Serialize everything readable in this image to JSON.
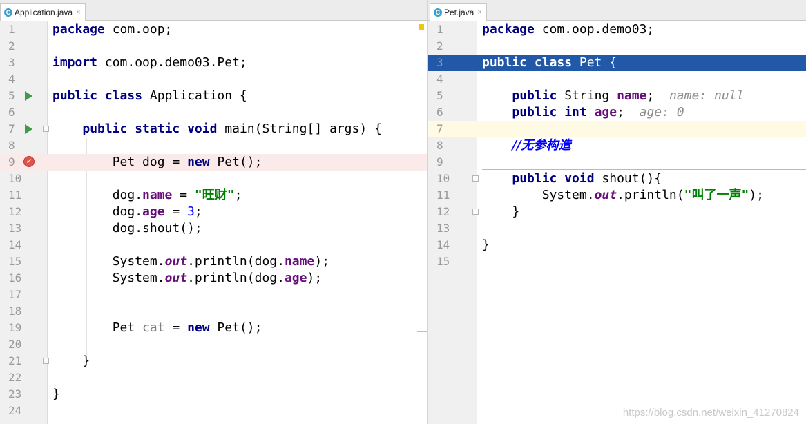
{
  "left_editor": {
    "tab": {
      "icon": "C",
      "name": "Application.java",
      "close": "×"
    },
    "lines": [
      {
        "n": "1",
        "tokens": [
          {
            "t": "package",
            "c": "kw"
          },
          {
            "t": " com.oop;"
          }
        ]
      },
      {
        "n": "2",
        "tokens": []
      },
      {
        "n": "3",
        "tokens": [
          {
            "t": "import",
            "c": "kw"
          },
          {
            "t": " com.oop.demo03.Pet;"
          }
        ]
      },
      {
        "n": "4",
        "tokens": []
      },
      {
        "n": "5",
        "gutter": "run",
        "tokens": [
          {
            "t": "public class",
            "c": "kw"
          },
          {
            "t": " Application {"
          }
        ]
      },
      {
        "n": "6",
        "tokens": []
      },
      {
        "n": "7",
        "gutter": "run",
        "fold": true,
        "tokens": [
          {
            "t": "    "
          },
          {
            "t": "public static void",
            "c": "kw"
          },
          {
            "t": " main(String[] args) {"
          }
        ]
      },
      {
        "n": "8",
        "tokens": []
      },
      {
        "n": "9",
        "gutter": "breakpoint",
        "highlight": "break",
        "tokens": [
          {
            "t": "        Pet dog = "
          },
          {
            "t": "new",
            "c": "kw"
          },
          {
            "t": " Pet();"
          }
        ]
      },
      {
        "n": "10",
        "tokens": []
      },
      {
        "n": "11",
        "tokens": [
          {
            "t": "        dog."
          },
          {
            "t": "name",
            "c": "fld"
          },
          {
            "t": " = "
          },
          {
            "t": "\"旺财\"",
            "c": "str"
          },
          {
            "t": ";"
          }
        ]
      },
      {
        "n": "12",
        "tokens": [
          {
            "t": "        dog."
          },
          {
            "t": "age",
            "c": "fld"
          },
          {
            "t": " = "
          },
          {
            "t": "3",
            "c": "num"
          },
          {
            "t": ";"
          }
        ]
      },
      {
        "n": "13",
        "tokens": [
          {
            "t": "        dog.shout();"
          }
        ]
      },
      {
        "n": "14",
        "tokens": []
      },
      {
        "n": "15",
        "tokens": [
          {
            "t": "        System."
          },
          {
            "t": "out",
            "c": "sfld"
          },
          {
            "t": ".println(dog."
          },
          {
            "t": "name",
            "c": "fld"
          },
          {
            "t": ");"
          }
        ]
      },
      {
        "n": "16",
        "tokens": [
          {
            "t": "        System."
          },
          {
            "t": "out",
            "c": "sfld"
          },
          {
            "t": ".println(dog."
          },
          {
            "t": "age",
            "c": "fld"
          },
          {
            "t": ");"
          }
        ]
      },
      {
        "n": "17",
        "tokens": []
      },
      {
        "n": "18",
        "tokens": []
      },
      {
        "n": "19",
        "tokens": [
          {
            "t": "        Pet "
          },
          {
            "t": "cat",
            "c": "unused"
          },
          {
            "t": " = "
          },
          {
            "t": "new",
            "c": "kw"
          },
          {
            "t": " Pet();"
          }
        ]
      },
      {
        "n": "20",
        "tokens": []
      },
      {
        "n": "21",
        "fold": true,
        "tokens": [
          {
            "t": "    }"
          }
        ]
      },
      {
        "n": "22",
        "tokens": []
      },
      {
        "n": "23",
        "tokens": [
          {
            "t": "}"
          }
        ]
      },
      {
        "n": "24",
        "tokens": []
      }
    ]
  },
  "right_editor": {
    "tab": {
      "icon": "C",
      "name": "Pet.java",
      "close": "×"
    },
    "lines": [
      {
        "n": "1",
        "tokens": [
          {
            "t": "package",
            "c": "kw"
          },
          {
            "t": " com.oop.demo03;"
          }
        ]
      },
      {
        "n": "2",
        "tokens": []
      },
      {
        "n": "3",
        "highlight": "selected",
        "tokens": [
          {
            "t": "public class",
            "c": "kw"
          },
          {
            "t": " Pet {"
          }
        ]
      },
      {
        "n": "4",
        "tokens": []
      },
      {
        "n": "5",
        "tokens": [
          {
            "t": "    "
          },
          {
            "t": "public",
            "c": "kw"
          },
          {
            "t": " String "
          },
          {
            "t": "name",
            "c": "fld"
          },
          {
            "t": ";  "
          },
          {
            "t": "name: null",
            "c": "hint"
          }
        ]
      },
      {
        "n": "6",
        "tokens": [
          {
            "t": "    "
          },
          {
            "t": "public int",
            "c": "kw"
          },
          {
            "t": " "
          },
          {
            "t": "age",
            "c": "fld"
          },
          {
            "t": ";  "
          },
          {
            "t": "age: 0",
            "c": "hint"
          }
        ]
      },
      {
        "n": "7",
        "highlight": "caret",
        "tokens": []
      },
      {
        "n": "8",
        "tokens": [
          {
            "t": "    "
          },
          {
            "t": "//无参构造",
            "c": "cmt"
          }
        ]
      },
      {
        "n": "9",
        "tokens": []
      },
      {
        "n": "10",
        "fold": true,
        "tokens": [
          {
            "t": "    "
          },
          {
            "t": "public void",
            "c": "kw"
          },
          {
            "t": " shout(){"
          }
        ]
      },
      {
        "n": "11",
        "tokens": [
          {
            "t": "        System."
          },
          {
            "t": "out",
            "c": "sfld"
          },
          {
            "t": ".println("
          },
          {
            "t": "\"叫了一声\"",
            "c": "str"
          },
          {
            "t": ");"
          }
        ]
      },
      {
        "n": "12",
        "fold": true,
        "tokens": [
          {
            "t": "    }"
          }
        ]
      },
      {
        "n": "13",
        "tokens": []
      },
      {
        "n": "14",
        "tokens": [
          {
            "t": "}"
          }
        ]
      },
      {
        "n": "15",
        "tokens": []
      }
    ]
  },
  "watermark": "https://blog.csdn.net/weixin_41270824"
}
